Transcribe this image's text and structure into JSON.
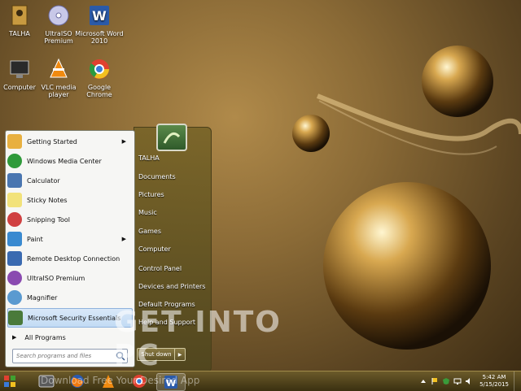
{
  "desktop": {
    "icons": [
      {
        "label": "TALHA",
        "icon": "user-folder-icon"
      },
      {
        "label": "UltraISO Premium",
        "icon": "disc-icon"
      },
      {
        "label": "Microsoft Word 2010",
        "icon": "word-icon"
      },
      {
        "label": "Computer",
        "icon": "computer-icon"
      },
      {
        "label": "VLC media player",
        "icon": "vlc-icon"
      },
      {
        "label": "Google Chrome",
        "icon": "chrome-icon"
      }
    ]
  },
  "start_menu": {
    "programs": [
      {
        "label": "Getting Started",
        "has_submenu": true,
        "color": "#e8b040"
      },
      {
        "label": "Windows Media Center",
        "has_submenu": false,
        "color": "#2f9a3a"
      },
      {
        "label": "Calculator",
        "has_submenu": false,
        "color": "#4a76b0"
      },
      {
        "label": "Sticky Notes",
        "has_submenu": false,
        "color": "#f2e27a"
      },
      {
        "label": "Snipping Tool",
        "has_submenu": false,
        "color": "#d04040"
      },
      {
        "label": "Paint",
        "has_submenu": true,
        "color": "#3a8ad0"
      },
      {
        "label": "Remote Desktop Connection",
        "has_submenu": false,
        "color": "#3a6ab0"
      },
      {
        "label": "UltraISO Premium",
        "has_submenu": false,
        "color": "#8a4ab0"
      },
      {
        "label": "Magnifier",
        "has_submenu": false,
        "color": "#5a9ad0"
      },
      {
        "label": "Microsoft Security Essentials",
        "has_submenu": false,
        "color": "#4a7a3a"
      }
    ],
    "all_programs": "All Programs",
    "search_placeholder": "Search programs and files",
    "right_links": [
      "TALHA",
      "Documents",
      "Pictures",
      "Music",
      "Games",
      "Computer",
      "Control Panel",
      "Devices and Printers",
      "Default Programs",
      "Help and Support"
    ],
    "shutdown_label": "Shut down"
  },
  "taskbar": {
    "items": [
      "start-orb-icon",
      "media-player-icon",
      "firefox-icon",
      "vlc-icon",
      "chrome-icon",
      "word-icon"
    ],
    "clock_time": "5:42 AM",
    "clock_date": "5/15/2015"
  },
  "watermark": {
    "text": "GET INTO PC",
    "subtext": "Download Free Your Desired App"
  },
  "colors": {
    "accent": "#8a7a44",
    "taskbar": "#3a3010"
  }
}
